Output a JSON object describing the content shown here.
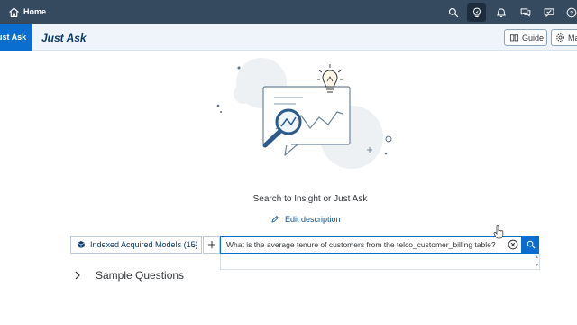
{
  "shell": {
    "home_label": "Home",
    "actions": [
      {
        "icon": "search-icon",
        "active": false
      },
      {
        "icon": "lightbulb-icon",
        "active": true
      },
      {
        "icon": "bell-icon",
        "active": false
      },
      {
        "icon": "chat-icon",
        "active": false
      },
      {
        "icon": "feedback-icon",
        "active": false
      },
      {
        "icon": "help-icon",
        "active": false
      }
    ]
  },
  "subheader": {
    "tab_label": "Just Ask",
    "title": "Just Ask",
    "guide_label": "Guide",
    "manage_label": "Ma"
  },
  "main": {
    "prompt_title": "Search to Insight or Just Ask",
    "edit_description": "Edit description"
  },
  "search": {
    "model_label": "Indexed Acquired Models (15)",
    "query": "What is the average tenure of customers from the telco_customer_billing table?"
  },
  "sample_questions": {
    "label": "Sample Questions"
  },
  "colors": {
    "shell_bg": "#354a5f",
    "accent": "#0a6ed1",
    "subheader_bg": "#eef4fa"
  }
}
